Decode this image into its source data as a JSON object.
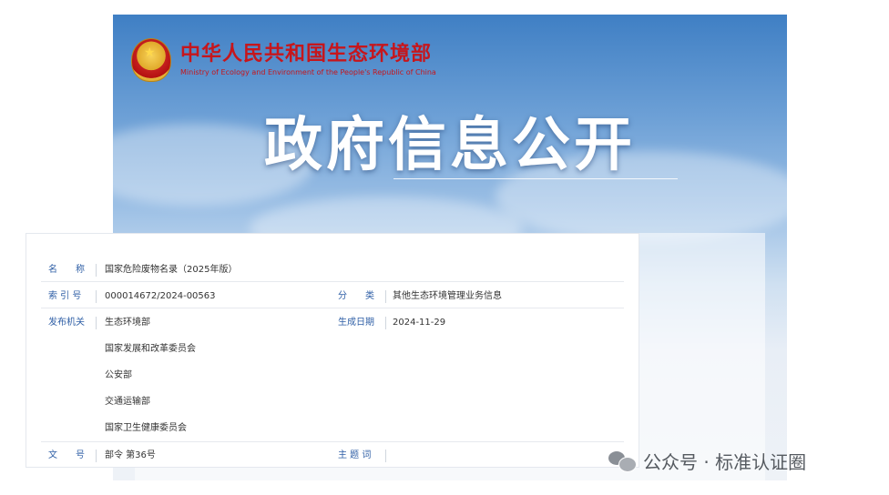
{
  "header": {
    "ministry_name_cn": "中华人民共和国生态环境部",
    "ministry_name_en": "Ministry of Ecology and Environment of the People's Republic of China"
  },
  "banner": {
    "title": "政府信息公开"
  },
  "info": {
    "name_label": "名　　称",
    "name_value": "国家危险废物名录（2025年版）",
    "index_label": "索 引 号",
    "index_value": "000014672/2024-00563",
    "category_label": "分　　类",
    "category_value": "其他生态环境管理业务信息",
    "issuer_label": "发布机关",
    "issuers": [
      "生态环境部",
      "国家发展和改革委员会",
      "公安部",
      "交通运输部",
      "国家卫生健康委员会"
    ],
    "date_label": "生成日期",
    "date_value": "2024-11-29",
    "doc_no_label": "文　　号",
    "doc_no_value": "部令 第36号",
    "subject_label": "主 题 词",
    "subject_value": ""
  },
  "watermark": {
    "text": "公众号 · 标准认证圈"
  },
  "colors": {
    "ministry_red": "#c6161c",
    "label_blue": "#2f5fa6"
  }
}
